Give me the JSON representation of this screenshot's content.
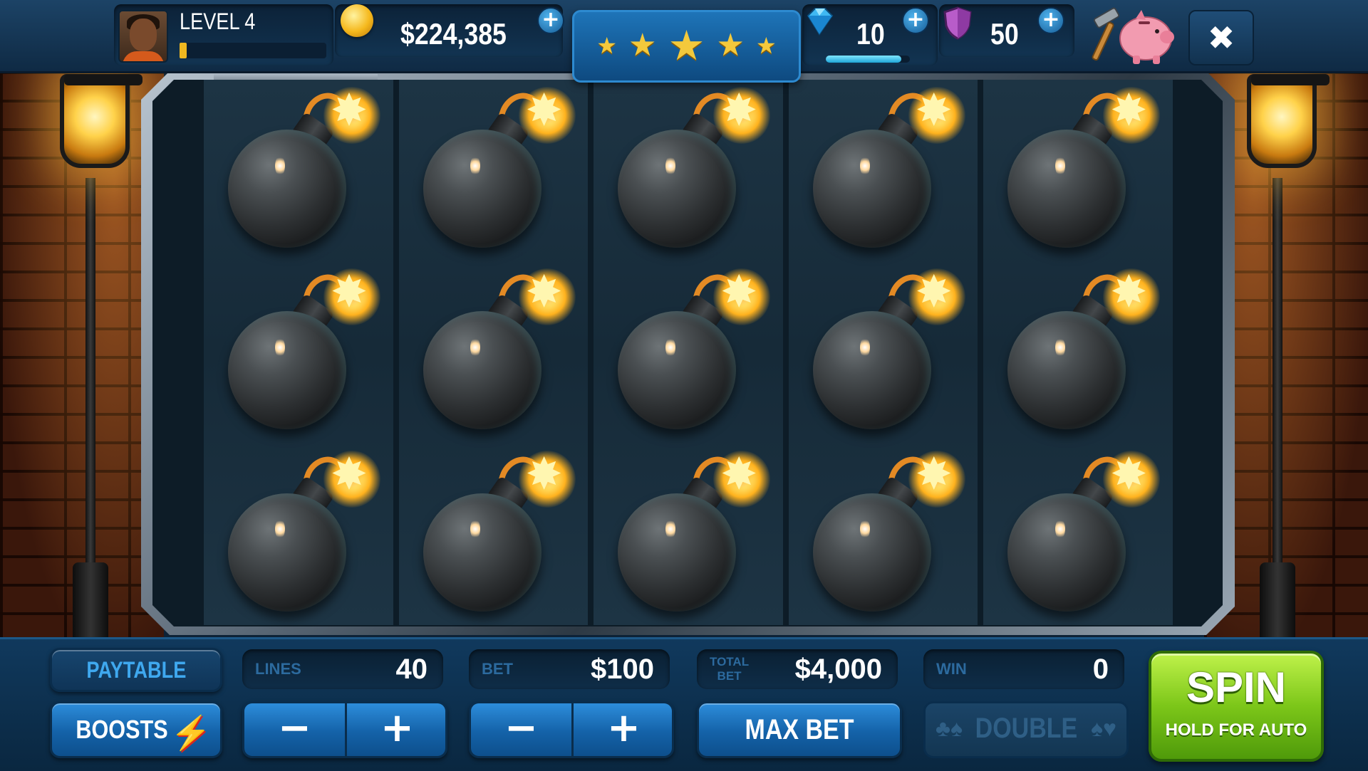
{
  "player": {
    "level_label": "LEVEL 4",
    "level_progress": 0.05
  },
  "currency": {
    "coins": "$224,385",
    "gems": "10",
    "gem_progress": 0.9,
    "shields": "50"
  },
  "stars": {
    "count": 5,
    "glyph": "★"
  },
  "reels": {
    "columns": 5,
    "rows": 3,
    "symbols": [
      [
        "bomb",
        "bomb",
        "bomb"
      ],
      [
        "bomb",
        "bomb",
        "bomb"
      ],
      [
        "bomb",
        "bomb",
        "bomb"
      ],
      [
        "bomb",
        "bomb",
        "bomb"
      ],
      [
        "bomb",
        "bomb",
        "bomb"
      ]
    ]
  },
  "controls": {
    "paytable_label": "PAYTABLE",
    "boosts_label": "BOOSTS",
    "lines_label": "LINES",
    "lines_value": "40",
    "bet_label": "BET",
    "bet_value": "$100",
    "total_bet_label_1": "TOTAL",
    "total_bet_label_2": "BET",
    "total_bet_value": "$4,000",
    "win_label": "WIN",
    "win_value": "0",
    "minus": "−",
    "plus": "+",
    "max_bet_label": "MAX BET",
    "double_label": "DOUBLE",
    "spin_label": "SPIN",
    "spin_sub_label": "HOLD FOR AUTO",
    "close_glyph": "✖"
  },
  "colors": {
    "accent_blue": "#1462a8",
    "spin_green": "#7cc619",
    "gold": "#f3c93c"
  },
  "icons": [
    "avatar",
    "coin-icon",
    "gem-icon",
    "shield-icon",
    "hammer-icon",
    "piggy-bank-icon",
    "close-icon",
    "bolt-icon",
    "card-suits-icon",
    "bomb-icon"
  ]
}
